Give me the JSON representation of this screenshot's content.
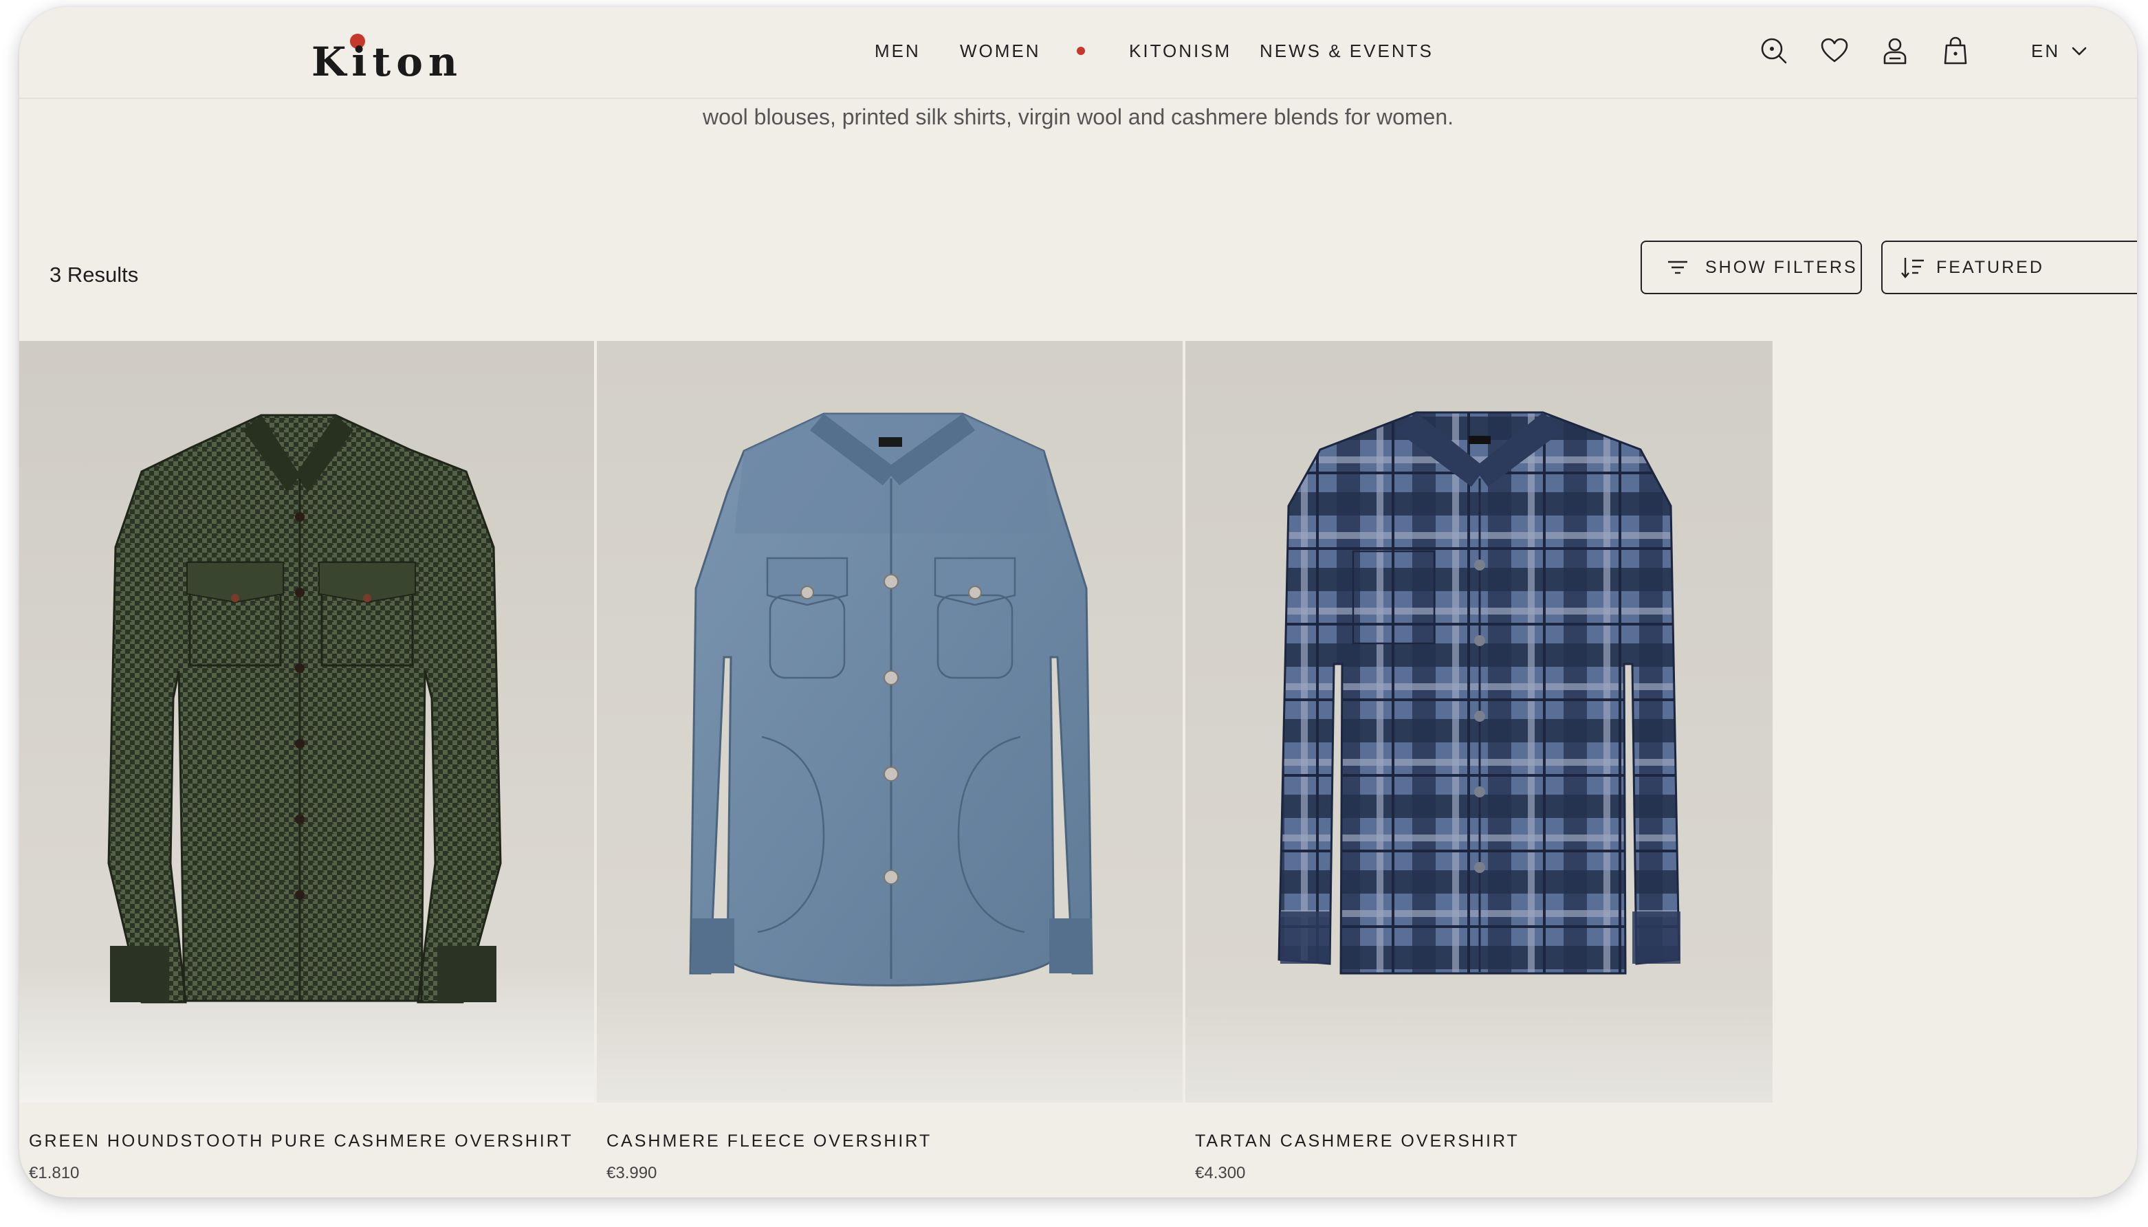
{
  "brand": {
    "logo_text": "Kiton",
    "accent_color": "#c8382a"
  },
  "nav": {
    "items": [
      "MEN",
      "WOMEN",
      "KITONISM",
      "NEWS & EVENTS"
    ],
    "language": "EN"
  },
  "header_icons": [
    "search-icon",
    "heart-icon",
    "account-icon",
    "bag-icon"
  ],
  "intro": {
    "text": "wool blouses, printed silk shirts, virgin wool and cashmere blends for women."
  },
  "toolbar": {
    "results_label": "3 Results",
    "filters_label": "SHOW FILTERS",
    "sort_label": "FEATURED"
  },
  "products": [
    {
      "name": "GREEN HOUNDSTOOTH PURE CASHMERE OVERSHIRT",
      "price": "€1.810",
      "color": "#3d4a33"
    },
    {
      "name": "CASHMERE FLEECE OVERSHIRT",
      "price": "€3.990",
      "color": "#6f8aa6"
    },
    {
      "name": "TARTAN CASHMERE OVERSHIRT",
      "price": "€4.300",
      "color": "#2e3d5c"
    }
  ]
}
